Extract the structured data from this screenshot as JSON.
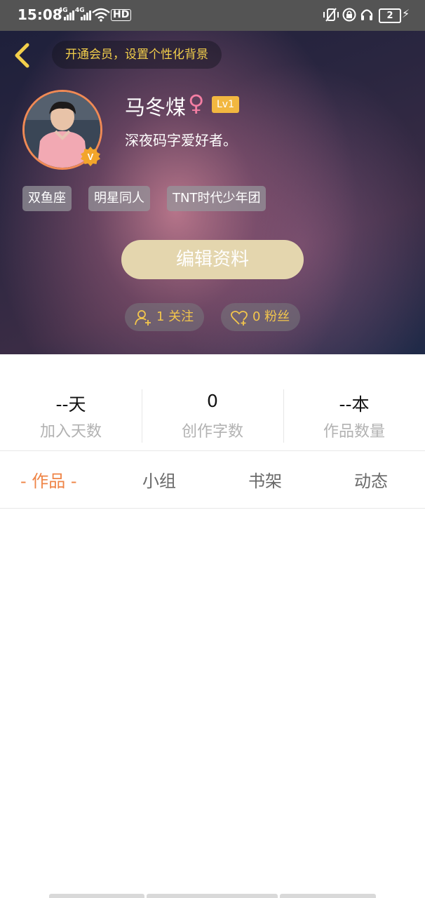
{
  "status_bar": {
    "time": "15:08",
    "signal_label": "4G",
    "hd_label": "HD",
    "battery_level": "2"
  },
  "header": {
    "vip_banner": "开通会员，设置个性化背景",
    "name": "马冬煤",
    "gender_symbol": "♀",
    "level": "Lv1",
    "bio": "深夜码字爱好者。",
    "tags": [
      "双鱼座",
      "明星同人",
      "TNT时代少年团"
    ],
    "edit_button": "编辑资料",
    "following": "1 关注",
    "followers": "0 粉丝"
  },
  "stats": [
    {
      "value": "--天",
      "label": "加入天数"
    },
    {
      "value": "0",
      "label": "创作字数"
    },
    {
      "value": "--本",
      "label": "作品数量"
    }
  ],
  "tabs": [
    {
      "label": "- 作品 -",
      "active": true
    },
    {
      "label": "小组",
      "active": false
    },
    {
      "label": "书架",
      "active": false
    },
    {
      "label": "动态",
      "active": false
    }
  ],
  "colors": {
    "accent_orange": "#ef8446",
    "vip_gold": "#f3cf4b",
    "edit_button_bg": "#e4d6ae",
    "level_badge": "#f2b740",
    "gender_pink": "#f47ea3"
  },
  "icons": [
    "back-chevron-icon",
    "follow-user-icon",
    "heart-icon",
    "verified-v-icon",
    "wifi-icon",
    "alarm-icon",
    "lock-icon",
    "headphones-icon",
    "charging-icon"
  ]
}
